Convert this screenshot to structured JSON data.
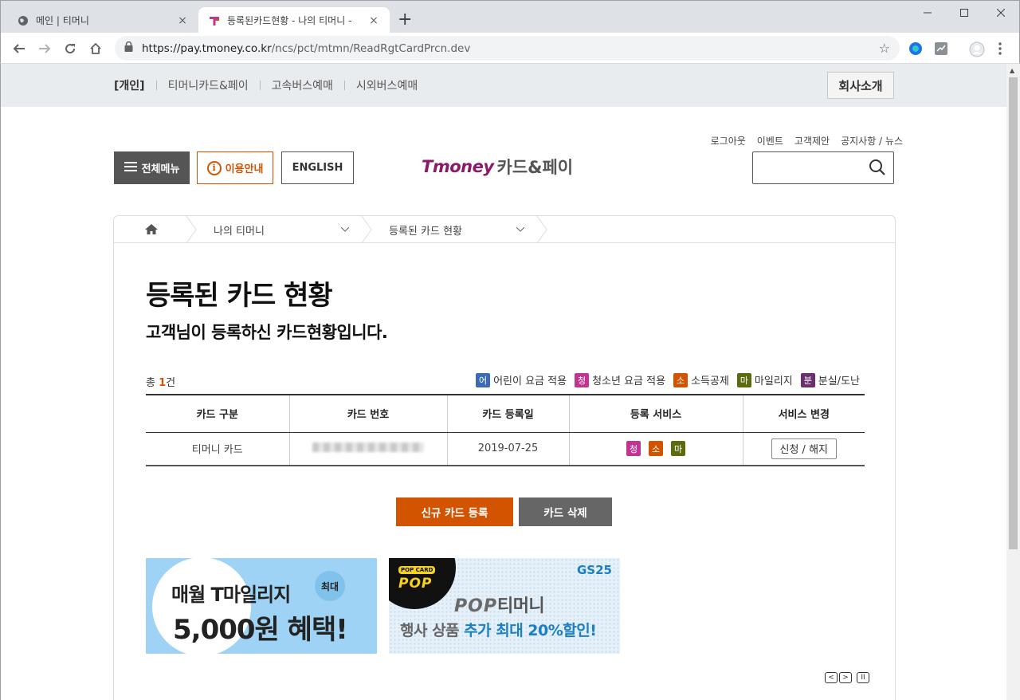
{
  "browser": {
    "tabs": [
      {
        "title": "메인 | 티머니",
        "close": "×"
      },
      {
        "title": "등록된카드현황 - 나의 티머니 - ",
        "close": "×"
      }
    ],
    "new_tab": "+",
    "url_host": "https://pay.tmoney.co.kr",
    "url_path": "/ncs/pct/mtmn/ReadRgtCardPrcn.dev"
  },
  "gnb": {
    "links": [
      "[개인]",
      "티머니카드&페이",
      "고속버스예매",
      "시외버스예매"
    ],
    "company": "회사소개"
  },
  "utility_links": [
    "로그아웃",
    "이벤트",
    "고객제안",
    "공지사항 / 뉴스"
  ],
  "header": {
    "menu_label": "전체메뉴",
    "guide_label": "이용안내",
    "english_label": "ENGLISH",
    "logo_brand": "Tmoney",
    "logo_rest": "카드&페이",
    "search_value": ""
  },
  "breadcrumb": [
    "나의 티머니",
    "등록된 카드 현황"
  ],
  "page": {
    "title": "등록된 카드 현황",
    "subtitle": "고객님이 등록하신 카드현황입니다.",
    "total_prefix": "총 ",
    "total_count": "1",
    "total_suffix": "건"
  },
  "legend": [
    {
      "badge": "어",
      "label": "어린이 요금 적용",
      "color": "#3d6bb3"
    },
    {
      "badge": "청",
      "label": "청소년 요금 적용",
      "color": "#c2348f"
    },
    {
      "badge": "소",
      "label": "소득공제",
      "color": "#d35400"
    },
    {
      "badge": "마",
      "label": "마일리지",
      "color": "#5b6b0e"
    },
    {
      "badge": "분",
      "label": "분실/도난",
      "color": "#6b2f6f"
    }
  ],
  "table": {
    "headers": [
      "카드 구분",
      "카드 번호",
      "카드 등록일",
      "등록 서비스",
      "서비스 변경"
    ],
    "rows": [
      {
        "type": "티머니 카드",
        "number": "",
        "date": "2019-07-25",
        "services": [
          "청",
          "소",
          "마"
        ],
        "action": "신청 / 해지"
      }
    ]
  },
  "actions": {
    "register": "신규 카드 등록",
    "delete": "카드 삭제"
  },
  "banners": [
    {
      "line1": "매월 T마일리지",
      "line2": "5,000원 혜택!",
      "bubble": "최대"
    },
    {
      "tag": "POP CARD",
      "logo": "POP",
      "brand": "GS25",
      "title_a": "POP",
      "title_b": "티머니",
      "sub_a": "행사 상품 ",
      "sub_b": "추가 최대 20%할인!"
    }
  ],
  "slider_controls": [
    "<",
    ">",
    "II"
  ],
  "colors": {
    "accent": "#d35400",
    "brand": "#8b1a6d"
  }
}
